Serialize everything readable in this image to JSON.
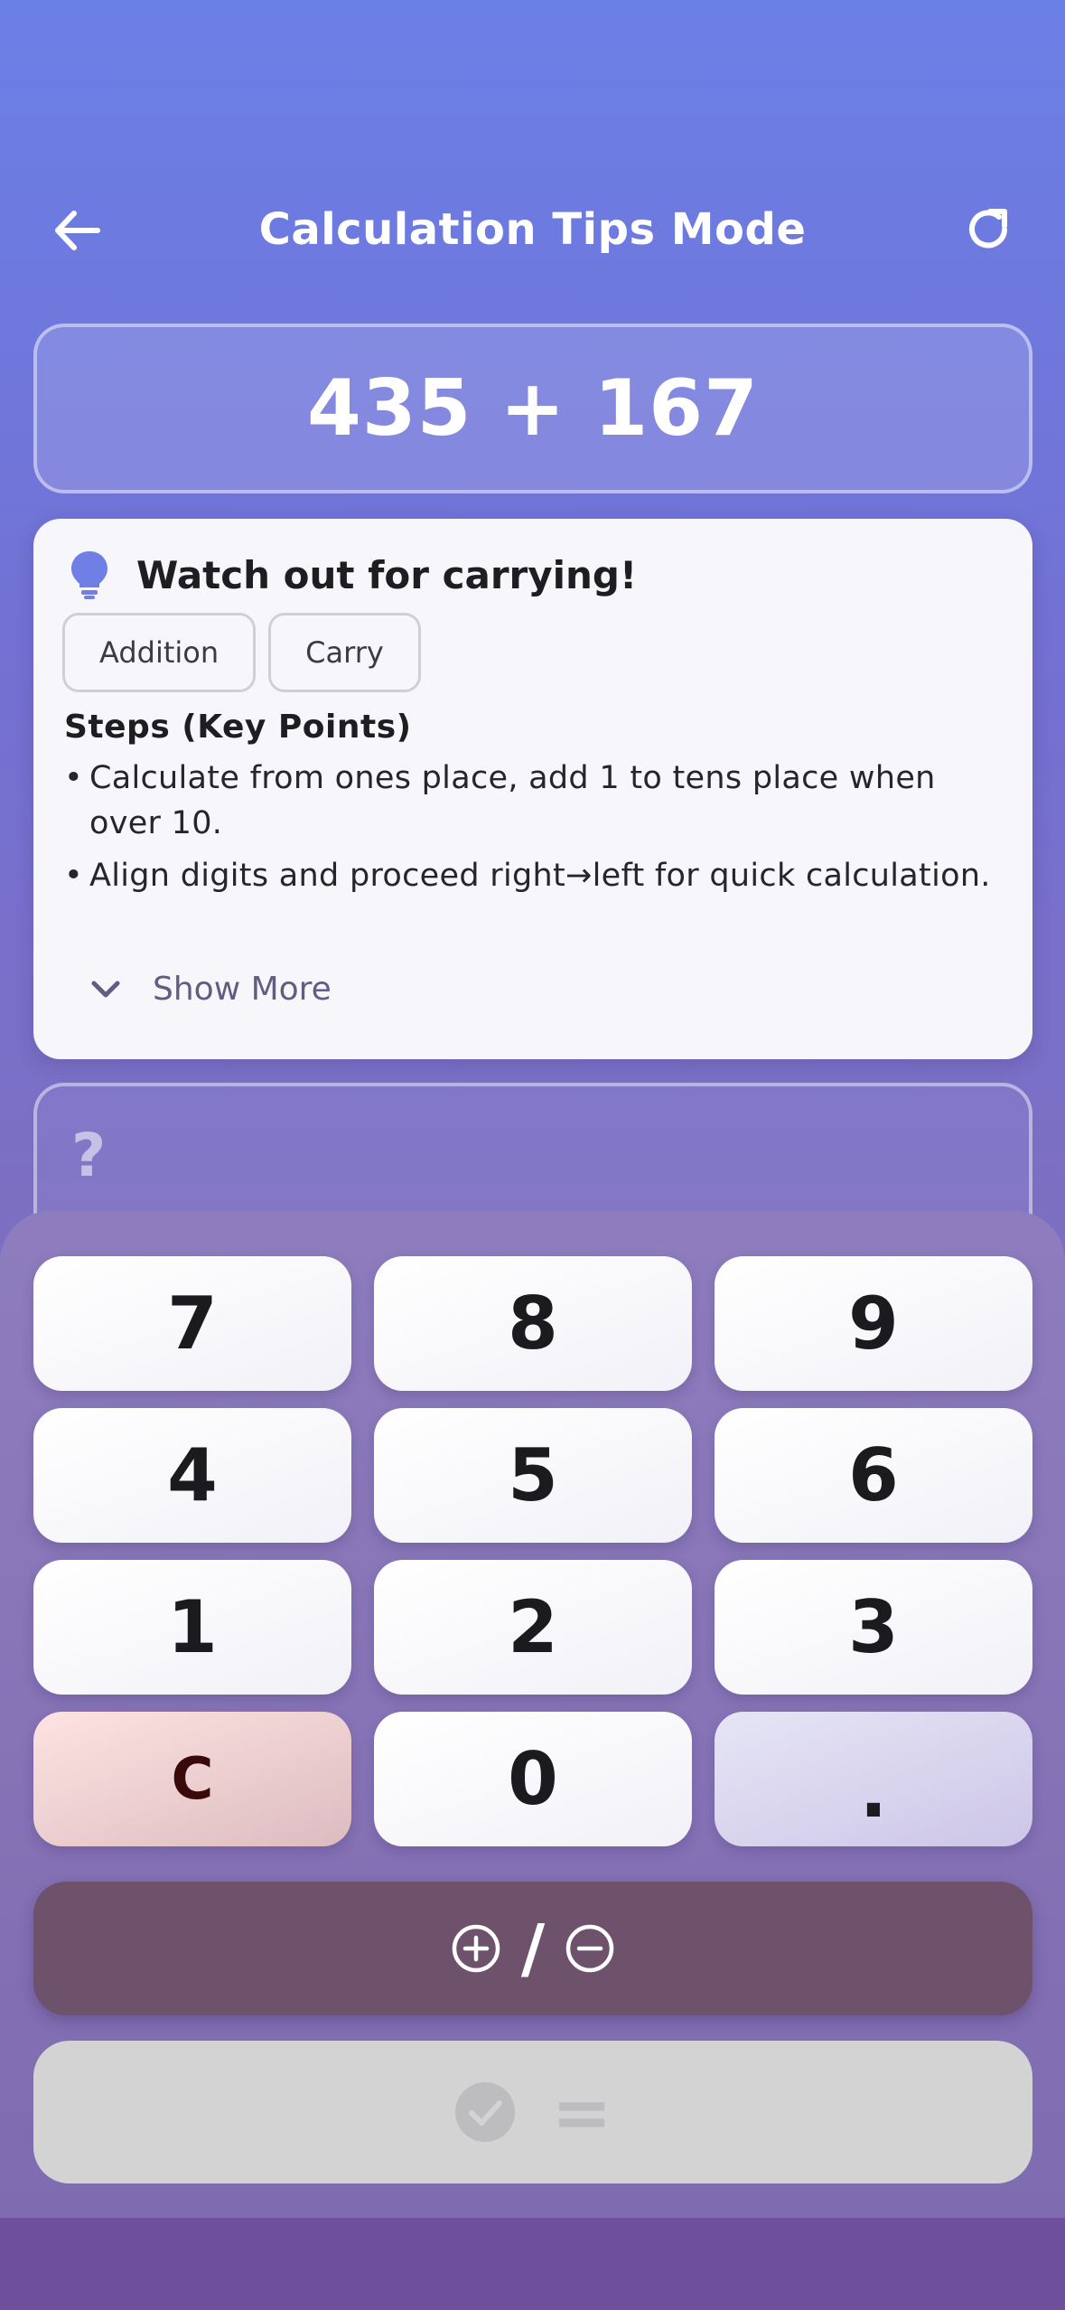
{
  "header": {
    "title": "Calculation Tips Mode",
    "back_icon": "arrow-left-icon",
    "refresh_icon": "refresh-icon"
  },
  "problem": {
    "expression": "435 + 167"
  },
  "tips": {
    "icon": "lightbulb-icon",
    "title": "Watch out for carrying!",
    "tags": [
      "Addition",
      "Carry"
    ],
    "steps_title": "Steps (Key Points)",
    "steps": [
      "Calculate from ones place, add 1 to tens place when over 10.",
      "Align digits and proceed right→left for quick calculation."
    ],
    "show_more_label": "Show More"
  },
  "answer": {
    "placeholder": "?"
  },
  "keypad": {
    "keys": [
      "7",
      "8",
      "9",
      "4",
      "5",
      "6",
      "1",
      "2",
      "3",
      "C",
      "0",
      "."
    ],
    "sign_toggle_slash": "/",
    "submit_equals": "="
  },
  "colors": {
    "accent_bulb": "#6f7fe6",
    "clear_key": "#fde3e1",
    "sign_button": "#6e526c",
    "submit_disabled": "#d3d3d4"
  }
}
